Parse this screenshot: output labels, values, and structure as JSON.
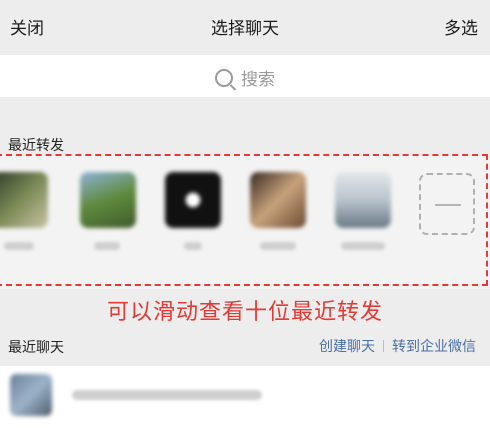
{
  "header": {
    "close_label": "关闭",
    "title": "选择聊天",
    "multi_select_label": "多选"
  },
  "search": {
    "label": "搜索"
  },
  "recent_forward": {
    "label": "最近转发",
    "items": [
      {
        "avatar": "blurred-photo-1"
      },
      {
        "avatar": "blurred-photo-2"
      },
      {
        "avatar": "blurred-photo-3"
      },
      {
        "avatar": "blurred-photo-4"
      },
      {
        "avatar": "blurred-photo-5"
      }
    ],
    "hint": "可以滑动查看十位最近转发"
  },
  "recent_chats": {
    "label": "最近聊天",
    "create_label": "创建聊天",
    "enterprise_label": "转到企业微信"
  },
  "colors": {
    "accent_red": "#e53935",
    "link_blue": "#4a6ea9",
    "background": "#ededed"
  }
}
